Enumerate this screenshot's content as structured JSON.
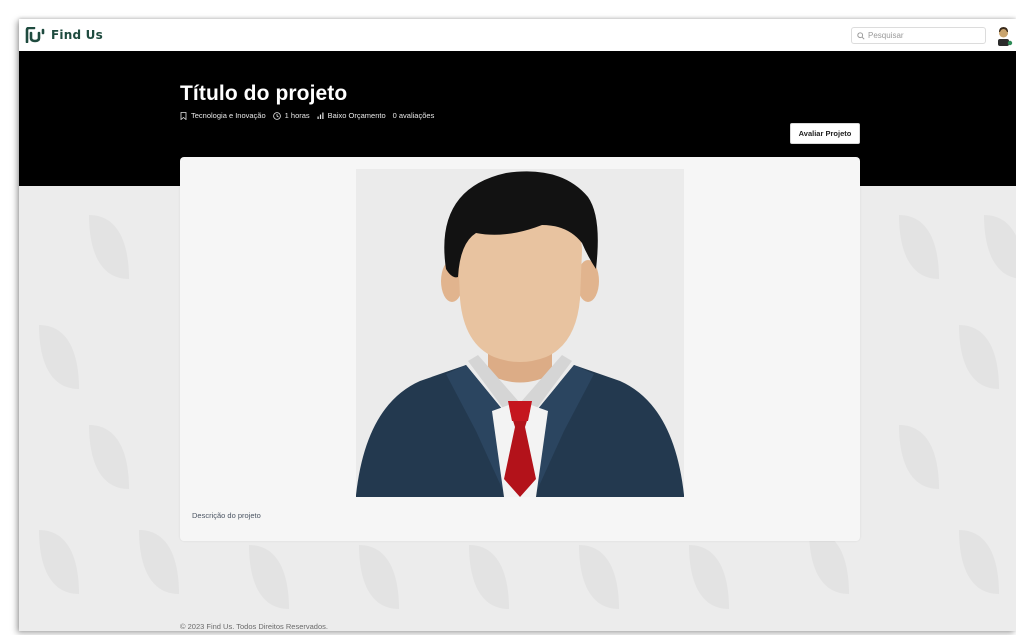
{
  "brand": {
    "name": "Find Us",
    "logo_icon": "find-us-logo-icon",
    "color": "#1f4b3f"
  },
  "search": {
    "placeholder": "Pesquisar",
    "icon": "search-icon"
  },
  "user": {
    "avatar_icon": "user-avatar-icon",
    "status_color": "#2e8b57"
  },
  "project": {
    "title": "Título do projeto",
    "category": "Tecnologia e Inovação",
    "duration": "1 horas",
    "budget": "Baixo Orçamento",
    "ratings": "0 avaliações",
    "rate_button": "Avaliar Projeto",
    "description": "Descrição do projeto",
    "image_icon": "person-placeholder-icon"
  },
  "footer": {
    "text": "© 2023 Find Us. Todos Direitos Reservados."
  },
  "colors": {
    "hero": "#000000",
    "background": "#ececec",
    "card": "#f6f6f6"
  }
}
